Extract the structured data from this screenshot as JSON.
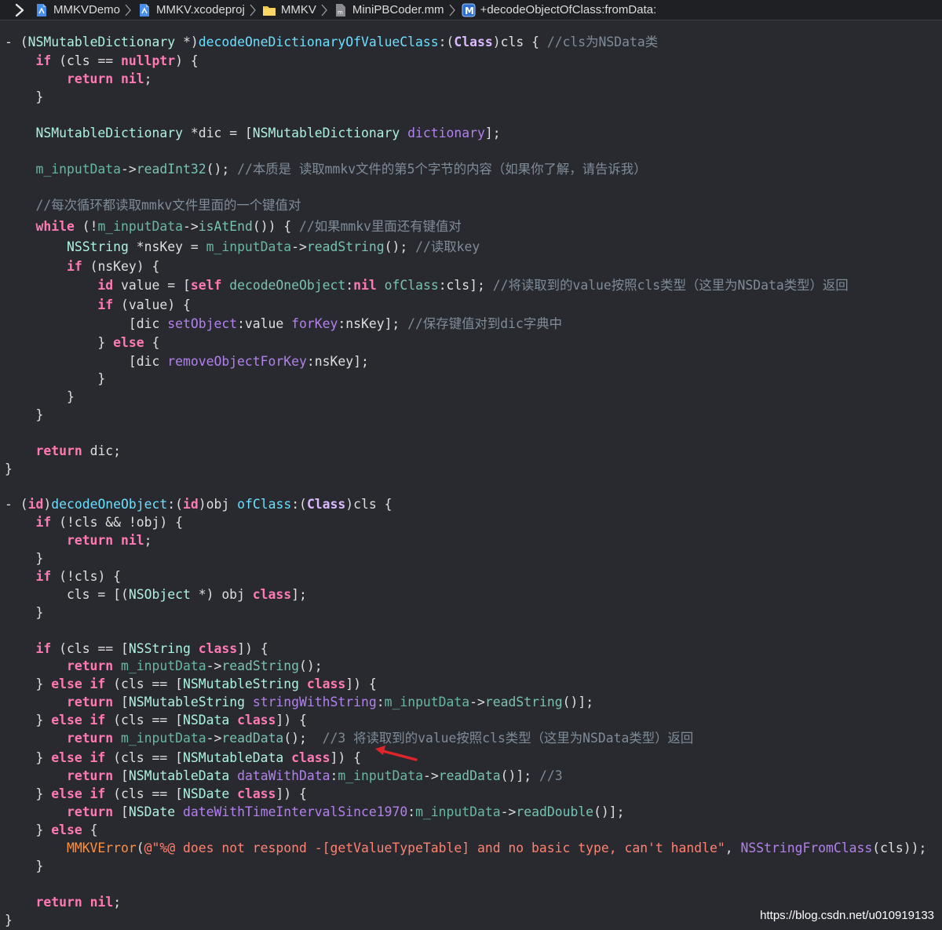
{
  "breadcrumb": [
    {
      "label": "MMKVDemo",
      "icon": "project-file-icon"
    },
    {
      "label": "MMKV.xcodeproj",
      "icon": "project-file-icon"
    },
    {
      "label": "MMKV",
      "icon": "folder-icon"
    },
    {
      "label": "MiniPBCoder.mm",
      "icon": "source-file-icon"
    },
    {
      "label": "+decodeObjectOfClass:fromData:",
      "icon": "method-icon"
    }
  ],
  "method_icon_letter": "M",
  "code_lines": [
    [
      [
        "pl",
        "- "
      ],
      [
        "pl",
        "("
      ],
      [
        "tp",
        "NSMutableDictionary"
      ],
      [
        "pl",
        " *)"
      ],
      [
        "pm",
        "decodeOneDictionaryOfValueClass"
      ],
      [
        "pl",
        ":("
      ],
      [
        "cls",
        "Class"
      ],
      [
        "pl",
        ")cls { "
      ],
      [
        "cm",
        "//cls为NSData类"
      ]
    ],
    [
      [
        "pl",
        "    "
      ],
      [
        "kw",
        "if"
      ],
      [
        "pl",
        " (cls == "
      ],
      [
        "kw",
        "nullptr"
      ],
      [
        "pl",
        ") {"
      ]
    ],
    [
      [
        "pl",
        "        "
      ],
      [
        "kw",
        "return"
      ],
      [
        "pl",
        " "
      ],
      [
        "kw",
        "nil"
      ],
      [
        "pl",
        ";"
      ]
    ],
    [
      [
        "pl",
        "    }"
      ]
    ],
    [],
    [
      [
        "pl",
        "    "
      ],
      [
        "tp",
        "NSMutableDictionary"
      ],
      [
        "pl",
        " *dic = ["
      ],
      [
        "tp",
        "NSMutableDictionary"
      ],
      [
        "pl",
        " "
      ],
      [
        "m",
        "dictionary"
      ],
      [
        "pl",
        "];"
      ]
    ],
    [],
    [
      [
        "pl",
        "    "
      ],
      [
        "v",
        "m_inputData"
      ],
      [
        "pl",
        "->"
      ],
      [
        "fn",
        "readInt32"
      ],
      [
        "pl",
        "(); "
      ],
      [
        "cm",
        "//本质是 读取mmkv文件的第5个字节的内容（如果你了解，请告诉我）"
      ]
    ],
    [],
    [
      [
        "pl",
        "    "
      ],
      [
        "cm",
        "//每次循环都读取mmkv文件里面的一个键值对"
      ]
    ],
    [
      [
        "pl",
        "    "
      ],
      [
        "kw",
        "while"
      ],
      [
        "pl",
        " (!"
      ],
      [
        "v",
        "m_inputData"
      ],
      [
        "pl",
        "->"
      ],
      [
        "fn",
        "isAtEnd"
      ],
      [
        "pl",
        "()) { "
      ],
      [
        "cm",
        "//如果mmkv里面还有键值对"
      ]
    ],
    [
      [
        "pl",
        "        "
      ],
      [
        "tp",
        "NSString"
      ],
      [
        "pl",
        " *nsKey = "
      ],
      [
        "v",
        "m_inputData"
      ],
      [
        "pl",
        "->"
      ],
      [
        "fn",
        "readString"
      ],
      [
        "pl",
        "(); "
      ],
      [
        "cm",
        "//读取key"
      ]
    ],
    [
      [
        "pl",
        "        "
      ],
      [
        "kw",
        "if"
      ],
      [
        "pl",
        " (nsKey) {"
      ]
    ],
    [
      [
        "pl",
        "            "
      ],
      [
        "kw",
        "id"
      ],
      [
        "pl",
        " value = ["
      ],
      [
        "kw",
        "self"
      ],
      [
        "pl",
        " "
      ],
      [
        "fn",
        "decodeOneObject"
      ],
      [
        "pl",
        ":"
      ],
      [
        "kw",
        "nil"
      ],
      [
        "pl",
        " "
      ],
      [
        "fn",
        "ofClass"
      ],
      [
        "pl",
        ":cls]; "
      ],
      [
        "cm",
        "//将读取到的value按照cls类型（这里为NSData类型）返回"
      ]
    ],
    [
      [
        "pl",
        "            "
      ],
      [
        "kw",
        "if"
      ],
      [
        "pl",
        " (value) {"
      ]
    ],
    [
      [
        "pl",
        "                ["
      ],
      [
        "pl",
        "dic "
      ],
      [
        "m",
        "setObject"
      ],
      [
        "pl",
        ":value "
      ],
      [
        "m",
        "forKey"
      ],
      [
        "pl",
        ":nsKey]; "
      ],
      [
        "cm",
        "//保存键值对到dic字典中"
      ]
    ],
    [
      [
        "pl",
        "            } "
      ],
      [
        "kw",
        "else"
      ],
      [
        "pl",
        " {"
      ]
    ],
    [
      [
        "pl",
        "                ["
      ],
      [
        "pl",
        "dic "
      ],
      [
        "m",
        "removeObjectForKey"
      ],
      [
        "pl",
        ":nsKey];"
      ]
    ],
    [
      [
        "pl",
        "            }"
      ]
    ],
    [
      [
        "pl",
        "        }"
      ]
    ],
    [
      [
        "pl",
        "    }"
      ]
    ],
    [],
    [
      [
        "pl",
        "    "
      ],
      [
        "kw",
        "return"
      ],
      [
        "pl",
        " dic;"
      ]
    ],
    [
      [
        "pl",
        "}"
      ]
    ],
    [],
    [
      [
        "pl",
        "- ("
      ],
      [
        "kw",
        "id"
      ],
      [
        "pl",
        ")"
      ],
      [
        "pm",
        "decodeOneObject"
      ],
      [
        "pl",
        ":("
      ],
      [
        "kw",
        "id"
      ],
      [
        "pl",
        ")obj "
      ],
      [
        "pm",
        "ofClass"
      ],
      [
        "pl",
        ":("
      ],
      [
        "cls",
        "Class"
      ],
      [
        "pl",
        ")cls {"
      ]
    ],
    [
      [
        "pl",
        "    "
      ],
      [
        "kw",
        "if"
      ],
      [
        "pl",
        " (!cls && !obj) {"
      ]
    ],
    [
      [
        "pl",
        "        "
      ],
      [
        "kw",
        "return"
      ],
      [
        "pl",
        " "
      ],
      [
        "kw",
        "nil"
      ],
      [
        "pl",
        ";"
      ]
    ],
    [
      [
        "pl",
        "    }"
      ]
    ],
    [
      [
        "pl",
        "    "
      ],
      [
        "kw",
        "if"
      ],
      [
        "pl",
        " (!cls) {"
      ]
    ],
    [
      [
        "pl",
        "        cls = [("
      ],
      [
        "tp",
        "NSObject"
      ],
      [
        "pl",
        " *) obj "
      ],
      [
        "kw",
        "class"
      ],
      [
        "pl",
        "];"
      ]
    ],
    [
      [
        "pl",
        "    }"
      ]
    ],
    [],
    [
      [
        "pl",
        "    "
      ],
      [
        "kw",
        "if"
      ],
      [
        "pl",
        " (cls == ["
      ],
      [
        "tp",
        "NSString"
      ],
      [
        "pl",
        " "
      ],
      [
        "kw",
        "class"
      ],
      [
        "pl",
        "]) {"
      ]
    ],
    [
      [
        "pl",
        "        "
      ],
      [
        "kw",
        "return"
      ],
      [
        "pl",
        " "
      ],
      [
        "v",
        "m_inputData"
      ],
      [
        "pl",
        "->"
      ],
      [
        "fn",
        "readString"
      ],
      [
        "pl",
        "();"
      ]
    ],
    [
      [
        "pl",
        "    } "
      ],
      [
        "kw",
        "else if"
      ],
      [
        "pl",
        " (cls == ["
      ],
      [
        "tp",
        "NSMutableString"
      ],
      [
        "pl",
        " "
      ],
      [
        "kw",
        "class"
      ],
      [
        "pl",
        "]) {"
      ]
    ],
    [
      [
        "pl",
        "        "
      ],
      [
        "kw",
        "return"
      ],
      [
        "pl",
        " ["
      ],
      [
        "tp",
        "NSMutableString"
      ],
      [
        "pl",
        " "
      ],
      [
        "m",
        "stringWithString"
      ],
      [
        "pl",
        ":"
      ],
      [
        "v",
        "m_inputData"
      ],
      [
        "pl",
        "->"
      ],
      [
        "fn",
        "readString"
      ],
      [
        "pl",
        "()];"
      ]
    ],
    [
      [
        "pl",
        "    } "
      ],
      [
        "kw",
        "else if"
      ],
      [
        "pl",
        " (cls == ["
      ],
      [
        "tp",
        "NSData"
      ],
      [
        "pl",
        " "
      ],
      [
        "kw",
        "class"
      ],
      [
        "pl",
        "]) {"
      ]
    ],
    [
      [
        "pl",
        "        "
      ],
      [
        "kw",
        "return"
      ],
      [
        "pl",
        " "
      ],
      [
        "v",
        "m_inputData"
      ],
      [
        "pl",
        "->"
      ],
      [
        "fn",
        "readData"
      ],
      [
        "pl",
        "();  "
      ],
      [
        "cm",
        "//3 将读取到的value按照cls类型（这里为NSData类型）返回"
      ]
    ],
    [
      [
        "pl",
        "    } "
      ],
      [
        "kw",
        "else if"
      ],
      [
        "pl",
        " (cls == ["
      ],
      [
        "tp",
        "NSMutableData"
      ],
      [
        "pl",
        " "
      ],
      [
        "kw",
        "class"
      ],
      [
        "pl",
        "]) {"
      ]
    ],
    [
      [
        "pl",
        "        "
      ],
      [
        "kw",
        "return"
      ],
      [
        "pl",
        " ["
      ],
      [
        "tp",
        "NSMutableData"
      ],
      [
        "pl",
        " "
      ],
      [
        "m",
        "dataWithData"
      ],
      [
        "pl",
        ":"
      ],
      [
        "v",
        "m_inputData"
      ],
      [
        "pl",
        "->"
      ],
      [
        "fn",
        "readData"
      ],
      [
        "pl",
        "()]; "
      ],
      [
        "cm",
        "//3"
      ]
    ],
    [
      [
        "pl",
        "    } "
      ],
      [
        "kw",
        "else if"
      ],
      [
        "pl",
        " (cls == ["
      ],
      [
        "tp",
        "NSDate"
      ],
      [
        "pl",
        " "
      ],
      [
        "kw",
        "class"
      ],
      [
        "pl",
        "]) {"
      ]
    ],
    [
      [
        "pl",
        "        "
      ],
      [
        "kw",
        "return"
      ],
      [
        "pl",
        " ["
      ],
      [
        "tp",
        "NSDate"
      ],
      [
        "pl",
        " "
      ],
      [
        "m",
        "dateWithTimeIntervalSince1970"
      ],
      [
        "pl",
        ":"
      ],
      [
        "v",
        "m_inputData"
      ],
      [
        "pl",
        "->"
      ],
      [
        "fn",
        "readDouble"
      ],
      [
        "pl",
        "()];"
      ]
    ],
    [
      [
        "pl",
        "    } "
      ],
      [
        "kw",
        "else"
      ],
      [
        "pl",
        " {"
      ]
    ],
    [
      [
        "pl",
        "        "
      ],
      [
        "mac",
        "MMKVError"
      ],
      [
        "pl",
        "("
      ],
      [
        "str",
        "@\"%@ does not respond -[getValueTypeTable] and no basic type, can't handle\""
      ],
      [
        "pl",
        ", "
      ],
      [
        "m",
        "NSStringFromClass"
      ],
      [
        "pl",
        "(cls));"
      ]
    ],
    [
      [
        "pl",
        "    }"
      ]
    ],
    [],
    [
      [
        "pl",
        "    "
      ],
      [
        "kw",
        "return"
      ],
      [
        "pl",
        " "
      ],
      [
        "kw",
        "nil"
      ],
      [
        "pl",
        ";"
      ]
    ],
    [
      [
        "pl",
        "}"
      ]
    ]
  ],
  "watermark": "https://blog.csdn.net/u010919133",
  "colors": {
    "background": "#292a30",
    "keyword": "#ff7ab2",
    "type": "#dabaff",
    "method": "#b281eb",
    "function": "#78c2b3",
    "comment": "#7f8c98",
    "string": "#ff8170",
    "macro": "#fd8f3f",
    "arrow": "#e0252a"
  }
}
